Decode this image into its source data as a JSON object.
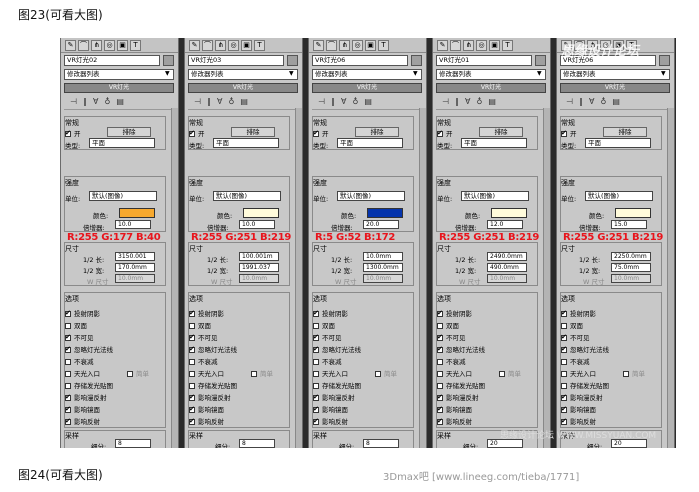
{
  "captions": {
    "top": "图23(可看大图)",
    "bottom": "图24(可看大图)"
  },
  "watermarks": {
    "corner": "思缘设计论坛",
    "bottom": "思缘设计论坛 WWW.MISSYUAN.COM",
    "footer": "3Dmax吧 [www.lineeg.com/tieba/1771]"
  },
  "common": {
    "modifier_list": "修改器列表",
    "stack_item": "VR灯光",
    "general_title": "常规",
    "on_label": "开",
    "exclude_label": "排除",
    "type_label": "类型:",
    "type_value": "平面",
    "intensity_title": "强度",
    "unit_label": "单位:",
    "unit_value": "默认(图像)",
    "color_label": "颜色:",
    "multiplier_label": "倍增器:",
    "size_title": "尺寸",
    "half_length_label": "1/2 长:",
    "half_width_label": "1/2 宽:",
    "w_size_label": "W 尺寸",
    "options_title": "选项",
    "options": [
      "投射阴影",
      "双面",
      "不可见",
      "忽略灯光法线",
      "不衰减",
      "天光入口",
      "存储发光贴图",
      "影响漫反射",
      "影响镜面",
      "影响反射"
    ],
    "simple_label": "简单",
    "sampling_title": "采样",
    "subdivs_label": "细分:"
  },
  "panels": [
    {
      "name": "VR灯光02",
      "color_hex": "#f7a92f",
      "rgb_text": "R:255 G:177 B:40",
      "multiplier": "10.0",
      "half_length": "3150.001",
      "half_width": "170.0mm",
      "w_size": "10.0mm",
      "subdivs": "8",
      "checks": [
        true,
        false,
        true,
        true,
        false,
        false,
        false,
        true,
        true,
        true
      ]
    },
    {
      "name": "VR灯光03",
      "color_hex": "#fffbdb",
      "rgb_text": "R:255 G:251 B:219",
      "multiplier": "10.0",
      "half_length": "100.001m",
      "half_width": "1991.037",
      "w_size": "10.0mm",
      "subdivs": "8",
      "checks": [
        true,
        false,
        true,
        true,
        false,
        false,
        false,
        true,
        true,
        true
      ]
    },
    {
      "name": "VR灯光06",
      "color_hex": "#0534ac",
      "rgb_text": "R:5 G:52 B:172",
      "multiplier": "20.0",
      "half_length": "10.0mm",
      "half_width": "1300.0mm",
      "w_size": "10.0mm",
      "subdivs": "8",
      "checks": [
        true,
        false,
        true,
        true,
        false,
        false,
        false,
        true,
        true,
        true
      ]
    },
    {
      "name": "VR灯光01",
      "color_hex": "#fffbdb",
      "rgb_text": "R:255 G:251 B:219",
      "multiplier": "12.0",
      "half_length": "2490.0mm",
      "half_width": "490.0mm",
      "w_size": "10.0mm",
      "subdivs": "20",
      "checks": [
        true,
        false,
        true,
        true,
        false,
        false,
        false,
        true,
        true,
        true
      ]
    },
    {
      "name": "VR灯光06",
      "color_hex": "#fffbdb",
      "rgb_text": "R:255 G:251 B:219",
      "multiplier": "15.0",
      "half_length": "2250.0mm",
      "half_width": "75.0mm",
      "w_size": "10.0mm",
      "subdivs": "20",
      "checks": [
        true,
        false,
        true,
        true,
        false,
        false,
        false,
        true,
        true,
        true
      ]
    }
  ]
}
